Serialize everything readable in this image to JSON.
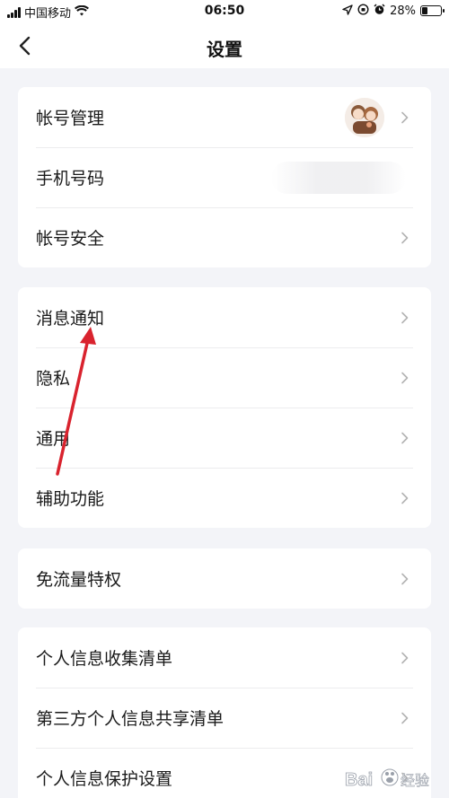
{
  "status_bar": {
    "carrier": "中国移动",
    "time": "06:50",
    "battery_percent": "28%"
  },
  "nav": {
    "title": "设置"
  },
  "groups": [
    {
      "items": [
        {
          "label": "帐号管理"
        },
        {
          "label": "手机号码"
        },
        {
          "label": "帐号安全"
        }
      ]
    },
    {
      "items": [
        {
          "label": "消息通知"
        },
        {
          "label": "隐私"
        },
        {
          "label": "通用"
        },
        {
          "label": "辅助功能"
        }
      ]
    },
    {
      "items": [
        {
          "label": "免流量特权"
        }
      ]
    },
    {
      "items": [
        {
          "label": "个人信息收集清单"
        },
        {
          "label": "第三方个人信息共享清单"
        },
        {
          "label": "个人信息保护设置"
        }
      ]
    }
  ],
  "colors": {
    "background": "#f3f4f8",
    "card": "#ffffff",
    "chevron": "#b3b3b3",
    "annotation_arrow": "#d9232e"
  },
  "watermark": {
    "text": "Bai经验"
  }
}
